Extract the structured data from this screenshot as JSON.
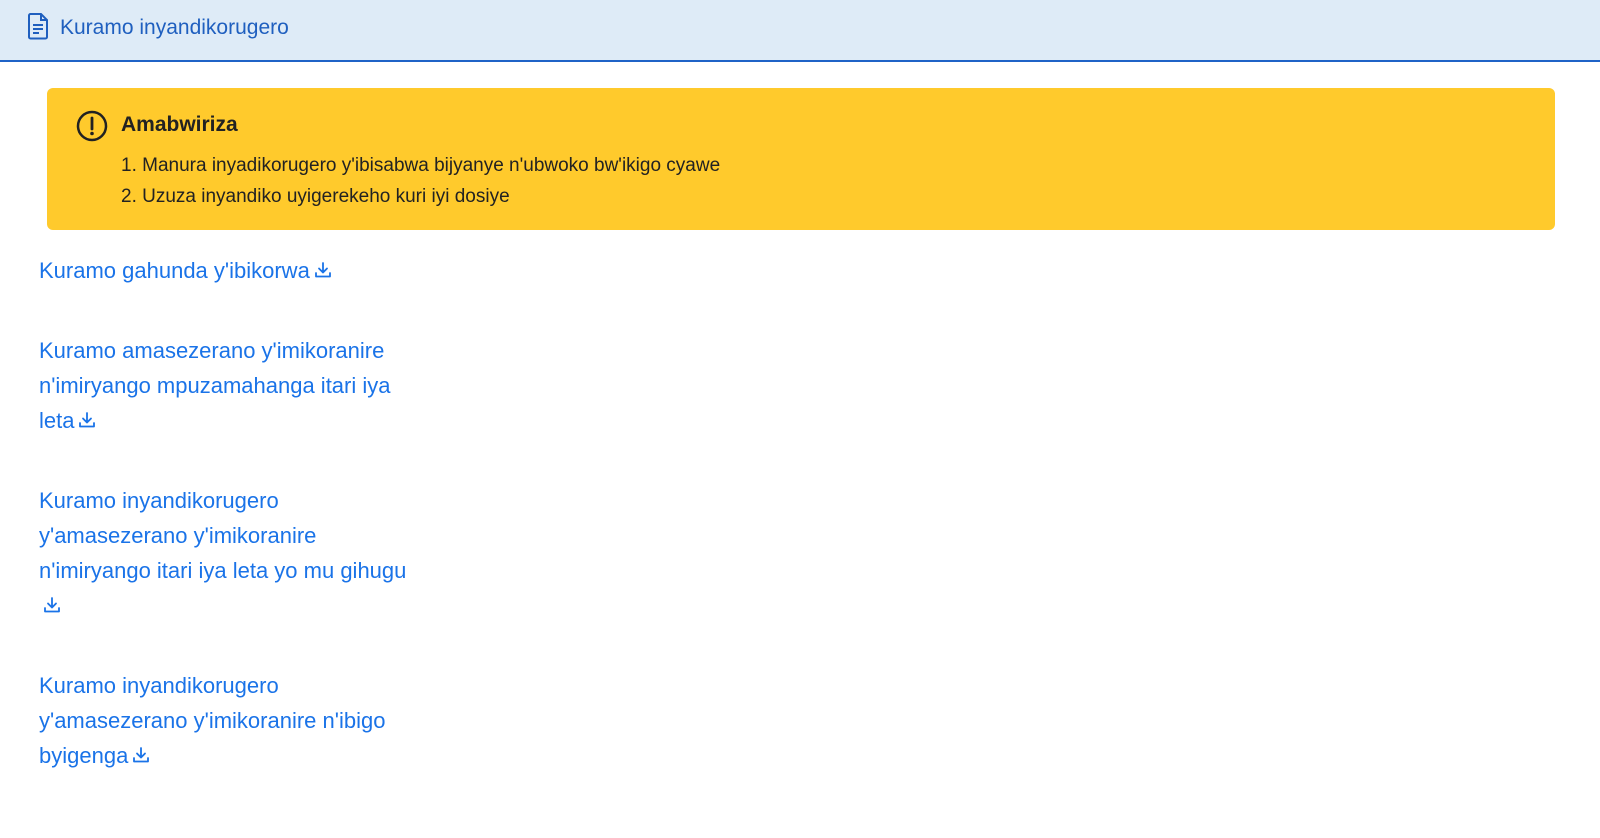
{
  "header": {
    "title": "Kuramo inyandikorugero",
    "icon": "document-icon"
  },
  "notice": {
    "title": "Amabwiriza",
    "icon": "exclamation-circle-icon",
    "items": [
      "1. Manura inyadikorugero y'ibisabwa bijyanye n'ubwoko bw'ikigo cyawe",
      "2. Uzuza inyandiko uyigerekeho kuri iyi dosiye"
    ]
  },
  "downloads": [
    {
      "label": "Kuramo gahunda y'ibikorwa",
      "icon": "download-icon"
    },
    {
      "label": "Kuramo amasezerano y'imikoranire n'imiryango mpuzamahanga itari iya leta",
      "icon": "download-icon"
    },
    {
      "label": "Kuramo inyandikorugero y'amasezerano y'imikoranire n'imiryango itari iya leta yo mu gihugu",
      "icon": "download-icon"
    },
    {
      "label": "Kuramo inyandikorugero y'amasezerano y'imikoranire n'ibigo byigenga",
      "icon": "download-icon"
    }
  ],
  "colors": {
    "header_bg": "#deebf7",
    "header_text": "#1f5fbf",
    "notice_bg": "#ffca2c",
    "link": "#1a73e8"
  }
}
